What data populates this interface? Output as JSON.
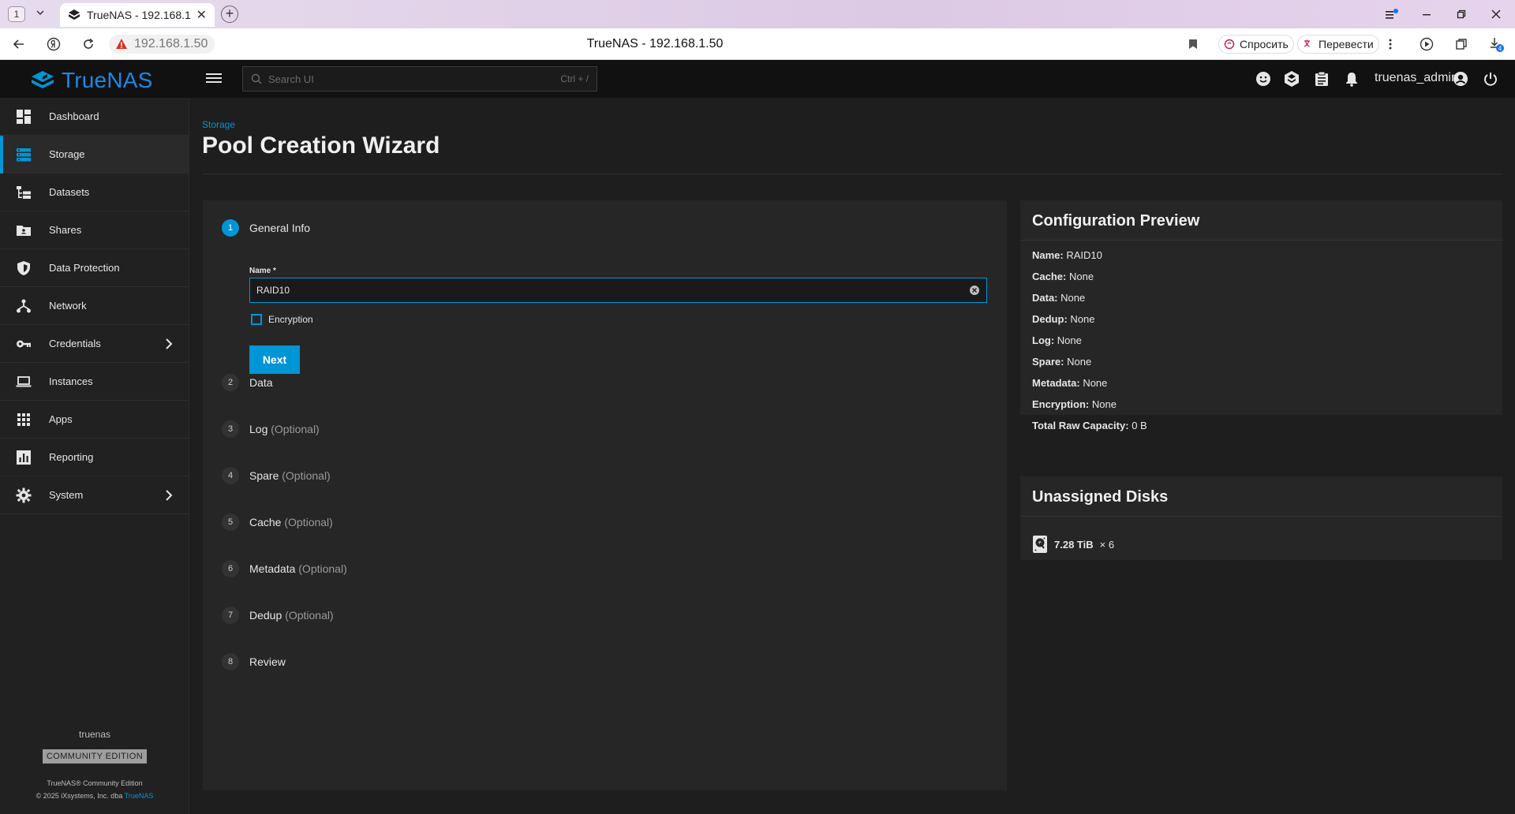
{
  "browser": {
    "tab_counter": "1",
    "tab_title": "TrueNAS - 192.168.1.50",
    "url": "192.168.1.50",
    "page_title": "TrueNAS - 192.168.1.50",
    "ask_label": "Спросить",
    "translate_label": "Перевести",
    "downloads_badge": "4"
  },
  "header": {
    "logo": "TrueNAS",
    "search_placeholder": "Search UI",
    "search_shortcut": "Ctrl + /",
    "username": "truenas_admin"
  },
  "sidebar": {
    "items": [
      {
        "label": "Dashboard",
        "icon": "dashboard-icon"
      },
      {
        "label": "Storage",
        "icon": "storage-icon",
        "active": true
      },
      {
        "label": "Datasets",
        "icon": "datasets-icon"
      },
      {
        "label": "Shares",
        "icon": "shares-icon"
      },
      {
        "label": "Data Protection",
        "icon": "shield-icon"
      },
      {
        "label": "Network",
        "icon": "network-icon"
      },
      {
        "label": "Credentials",
        "icon": "key-icon",
        "expandable": true
      },
      {
        "label": "Instances",
        "icon": "laptop-icon"
      },
      {
        "label": "Apps",
        "icon": "apps-grid-icon"
      },
      {
        "label": "Reporting",
        "icon": "chart-icon"
      },
      {
        "label": "System",
        "icon": "gear-icon",
        "expandable": true
      }
    ],
    "hostname": "truenas",
    "edition_badge": "COMMUNITY EDITION",
    "product": "TrueNAS® Community Edition",
    "copyright": "© 2025 iXsystems, Inc. dba",
    "copyright_brand": "TrueNAS"
  },
  "page": {
    "breadcrumb": "Storage",
    "title": "Pool Creation Wizard"
  },
  "wizard": {
    "steps": [
      {
        "num": "1",
        "label": "General Info",
        "optional": ""
      },
      {
        "num": "2",
        "label": "Data",
        "optional": ""
      },
      {
        "num": "3",
        "label": "Log",
        "optional": "(Optional)"
      },
      {
        "num": "4",
        "label": "Spare",
        "optional": "(Optional)"
      },
      {
        "num": "5",
        "label": "Cache",
        "optional": "(Optional)"
      },
      {
        "num": "6",
        "label": "Metadata",
        "optional": "(Optional)"
      },
      {
        "num": "7",
        "label": "Dedup",
        "optional": "(Optional)"
      },
      {
        "num": "8",
        "label": "Review",
        "optional": ""
      }
    ],
    "name_label": "Name *",
    "name_value": "RAID10",
    "encryption_label": "Encryption",
    "encryption_checked": false,
    "next_label": "Next"
  },
  "preview": {
    "title": "Configuration Preview",
    "rows": [
      {
        "key": "Name:",
        "value": "RAID10"
      },
      {
        "key": "Cache:",
        "value": "None"
      },
      {
        "key": "Data:",
        "value": "None"
      },
      {
        "key": "Dedup:",
        "value": "None"
      },
      {
        "key": "Log:",
        "value": "None"
      },
      {
        "key": "Spare:",
        "value": "None"
      },
      {
        "key": "Metadata:",
        "value": "None"
      },
      {
        "key": "Encryption:",
        "value": "None"
      },
      {
        "key": "Total Raw Capacity:",
        "value": "0 B"
      }
    ]
  },
  "unassigned": {
    "title": "Unassigned Disks",
    "disk_size": "7.28 TiB",
    "disk_count": "× 6"
  },
  "colors": {
    "accent": "#0095d5",
    "header_bg": "#111111",
    "sidebar_bg": "#212121",
    "card_bg": "#262626"
  }
}
